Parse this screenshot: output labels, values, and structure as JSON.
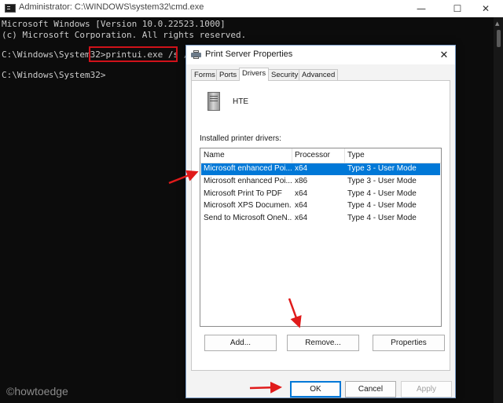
{
  "cmd": {
    "title": "Administrator: C:\\WINDOWS\\system32\\cmd.exe",
    "controls": {
      "minimize": "—",
      "maximize": "☐",
      "close": "✕"
    },
    "lines": [
      "Microsoft Windows [Version 10.0.22523.1000]",
      "(c) Microsoft Corporation. All rights reserved.",
      "",
      "C:\\Windows\\System32>printui.exe /s /t2",
      "",
      "C:\\Windows\\System32>"
    ],
    "prompt": "C:\\Windows\\System32>",
    "command": "printui.exe /s /t2",
    "prompt2": "C:\\Windows\\System32>"
  },
  "watermark": "©howtoedge",
  "dialog": {
    "title": "Print Server Properties",
    "close": "✕",
    "tabs": [
      "Forms",
      "Ports",
      "Drivers",
      "Security",
      "Advanced"
    ],
    "active_tab": "Drivers",
    "server_name": "HTE",
    "drivers_label": "Installed printer drivers:",
    "columns": [
      "Name",
      "Processor",
      "Type"
    ],
    "rows": [
      {
        "name": "Microsoft enhanced Poi...",
        "processor": "x64",
        "type": "Type 3 - User Mode",
        "selected": true
      },
      {
        "name": "Microsoft enhanced Poi...",
        "processor": "x86",
        "type": "Type 3 - User Mode",
        "selected": false
      },
      {
        "name": "Microsoft Print To PDF",
        "processor": "x64",
        "type": "Type 4 - User Mode",
        "selected": false
      },
      {
        "name": "Microsoft XPS Documen...",
        "processor": "x64",
        "type": "Type 4 - User Mode",
        "selected": false
      },
      {
        "name": "Send to Microsoft OneN...",
        "processor": "x64",
        "type": "Type 4 - User Mode",
        "selected": false
      }
    ],
    "buttons": {
      "add": "Add...",
      "remove": "Remove...",
      "properties": "Properties",
      "ok": "OK",
      "cancel": "Cancel",
      "apply": "Apply"
    }
  },
  "colors": {
    "highlight_box": "#d0121a",
    "arrow": "#e01b1b",
    "selection": "#0078d7"
  }
}
